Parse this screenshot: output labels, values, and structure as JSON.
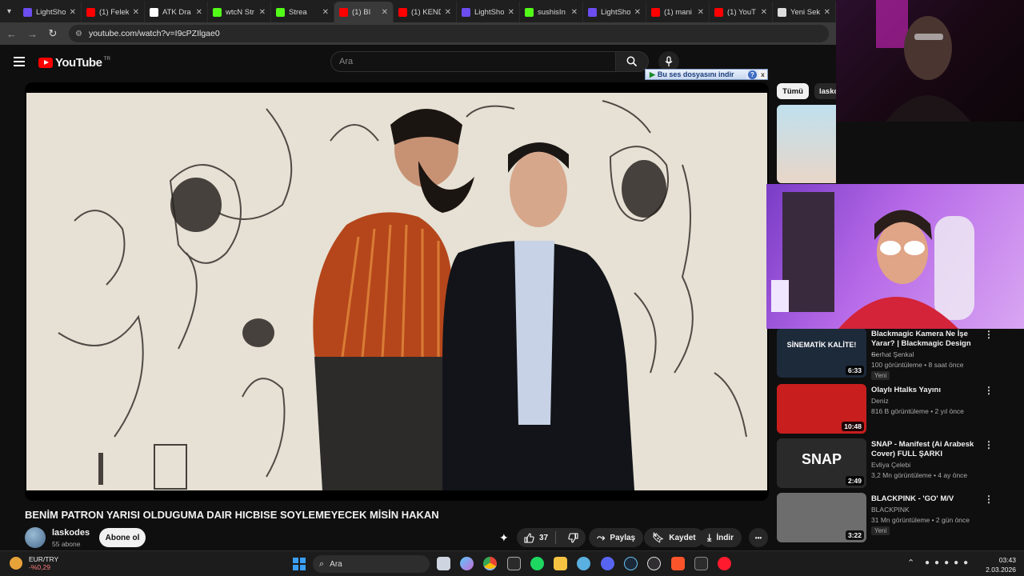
{
  "browser": {
    "tabs": [
      {
        "title": "LightSho",
        "favicon_color": "#6b4df0",
        "icon": "lightshot-icon"
      },
      {
        "title": "(1) Felek",
        "favicon_color": "#ff0000",
        "icon": "youtube-icon"
      },
      {
        "title": "ATK Dra",
        "favicon_color": "#ffffff",
        "icon": "w-icon"
      },
      {
        "title": "wtcN Str",
        "favicon_color": "#53fc18",
        "icon": "kick-icon"
      },
      {
        "title": "Strea",
        "favicon_color": "#53fc18",
        "icon": "kick-icon"
      },
      {
        "title": "(1) BI",
        "favicon_color": "#ff0000",
        "icon": "youtube-icon",
        "active": true
      },
      {
        "title": "(1) KEND",
        "favicon_color": "#ff0000",
        "icon": "youtube-icon"
      },
      {
        "title": "LightSho",
        "favicon_color": "#6b4df0",
        "icon": "lightshot-icon"
      },
      {
        "title": "sushisIn",
        "favicon_color": "#53fc18",
        "icon": "kick-icon"
      },
      {
        "title": "LightSho",
        "favicon_color": "#6b4df0",
        "icon": "lightshot-icon"
      },
      {
        "title": "(1) mani",
        "favicon_color": "#ff0000",
        "icon": "youtube-icon"
      },
      {
        "title": "(1) YouT",
        "favicon_color": "#ff0000",
        "icon": "youtube-icon"
      },
      {
        "title": "Yeni Sek",
        "favicon_color": "#dddddd",
        "icon": "chrome-icon"
      }
    ],
    "url": "youtube.com/watch?v=I9cPZIlgae0"
  },
  "yt": {
    "logo_word": "YouTube",
    "country": "TR",
    "search_placeholder": "Ara",
    "download_popup": "Bu ses dosyasını indir",
    "download_help": "?",
    "download_close": "x"
  },
  "video": {
    "title": "BENİM PATRON YARISI OLDUGUMA DAIR HICBISE SOYLEMEYECEK MİSİN HAKAN",
    "channel": "laskodes",
    "subscribers": "55 abone",
    "subscribe_label": "Abone ol",
    "likes": "37",
    "share_label": "Paylaş",
    "save_label": "Kaydet",
    "download_label": "İndir",
    "more_label": "•••"
  },
  "chips": {
    "all": "Tümü",
    "second": "lasko"
  },
  "sidebar": [
    {
      "title": "Blackmagic Kamera Ne İşe Yarar? | Blackmagic Design ...",
      "channel": "Serhat Şenkal",
      "stats": "100 görüntüleme • 8 saat önce",
      "badge": "Yeni",
      "duration": "6:33",
      "thumb_text": "SİNEMATİK KALİTE!",
      "thumb_color": "#1d2a3a"
    },
    {
      "title": "Olaylı Htalks Yayını",
      "channel": "Deniz",
      "stats": "816 B görüntüleme • 2 yıl önce",
      "badge": "",
      "duration": "10:48",
      "thumb_text": "",
      "thumb_color": "#c81e1e"
    },
    {
      "title": "SNAP - Manifest (Ai Arabesk Cover) FULL ŞARKI",
      "channel": "Evliya Çelebi",
      "stats": "3,2 Mn görüntüleme • 4 ay önce",
      "badge": "",
      "duration": "2:49",
      "thumb_text": "SNAP",
      "thumb_color": "#2a2a2a"
    },
    {
      "title": "BLACKPINK - 'GO' M/V",
      "channel": "BLACKPINK",
      "stats": "31 Mn görüntüleme • 2 gün önce",
      "badge": "Yeni",
      "duration": "3:22",
      "thumb_text": "",
      "thumb_color": "#6d6d6d"
    }
  ],
  "taskbar": {
    "ticker_name": "EUR/TRY",
    "ticker_change": "-%0,29",
    "search_placeholder": "Ara",
    "time": "03:43",
    "date": "2.03.2026"
  }
}
